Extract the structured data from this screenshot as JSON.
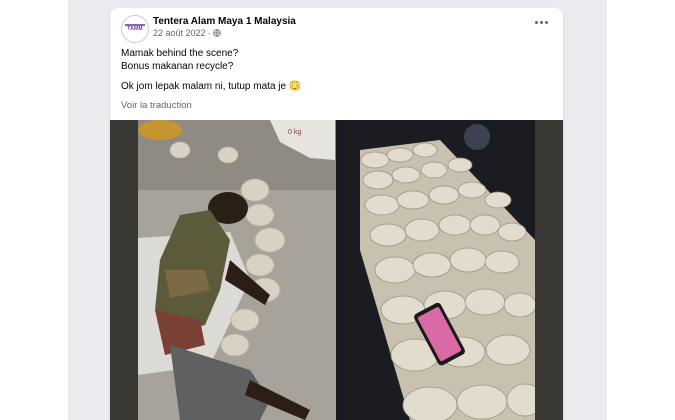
{
  "post": {
    "page_name": "Tentera Alam Maya 1 Malaysia",
    "avatar_text": "TAMM",
    "date": "22 août 2022",
    "separator": "·",
    "caption_lines": [
      "Mamak behind the scene?",
      "Bonus makanan recycle?",
      "Ok jom lepak malam ni, tutup mata je 😳"
    ],
    "translate_label": "Voir la traduction",
    "bag_text": "0 kg"
  },
  "icons": {
    "globe": "globe-icon",
    "more": "more-options-icon"
  },
  "colors": {
    "page_background": "#e9ebee",
    "card_background": "#ffffff",
    "primary_text": "#050505",
    "secondary_text": "#65676b",
    "phone_screen": "#d96aa6"
  }
}
